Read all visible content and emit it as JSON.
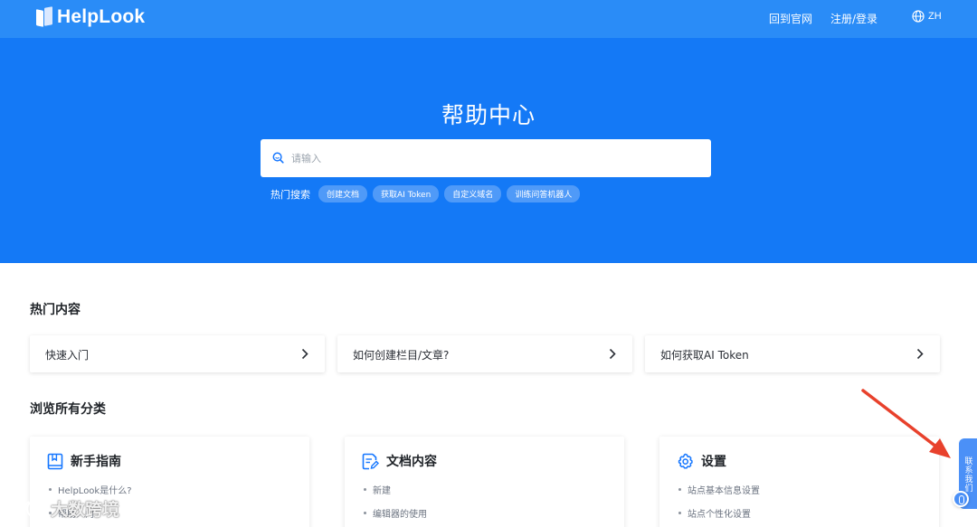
{
  "brand": {
    "name": "HelpLook"
  },
  "nav": {
    "official_site": "回到官网",
    "login": "注册/登录",
    "language": "ZH"
  },
  "hero": {
    "title": "帮助中心",
    "search_placeholder": "请输入",
    "hot_search_label": "热门搜索",
    "hot_search_tags": [
      "创建文档",
      "获取AI Token",
      "自定义域名",
      "训练问答机器人"
    ]
  },
  "hot_content": {
    "title": "热门内容",
    "items": [
      "快速入门",
      "如何创建栏目/文章?",
      "如何获取AI Token"
    ]
  },
  "categories": {
    "title": "浏览所有分类",
    "items": [
      {
        "title": "新手指南",
        "icon": "book-icon",
        "links": [
          "HelpLook是什么?",
          "帮助入门"
        ]
      },
      {
        "title": "文档内容",
        "icon": "document-edit-icon",
        "links": [
          "新建",
          "编辑器的使用"
        ]
      },
      {
        "title": "设置",
        "icon": "gear-icon",
        "links": [
          "站点基本信息设置",
          "站点个性化设置"
        ]
      }
    ]
  },
  "contact": {
    "label": "联系我们"
  },
  "watermark": {
    "text": "大数跨境"
  },
  "colors": {
    "topbar": "#2a8cf7",
    "hero": "#1479f6",
    "accent": "#1677ff",
    "annotation_arrow": "#e8412c"
  }
}
